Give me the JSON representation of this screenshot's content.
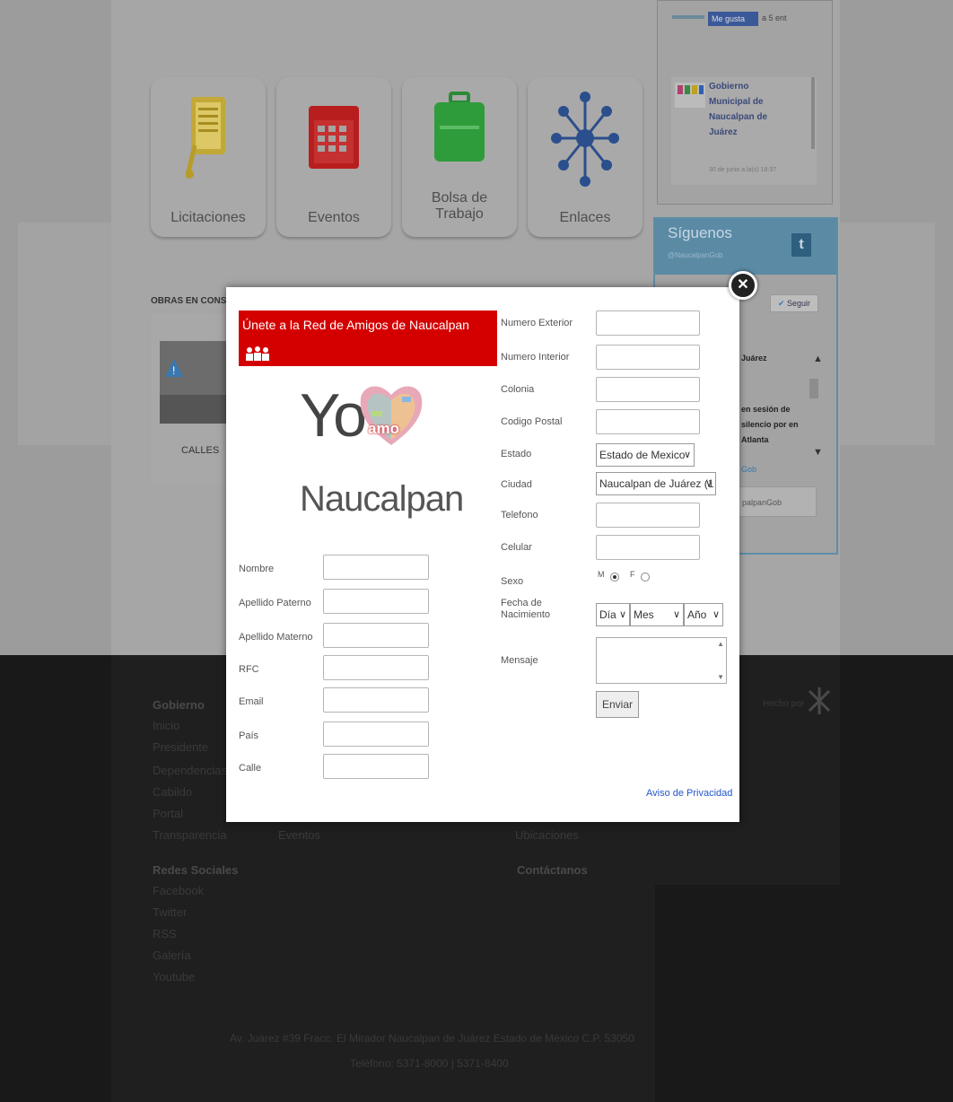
{
  "tiles": [
    {
      "label": "Licitaciones",
      "icon": "clipboard-icon",
      "color": "#d4b62a"
    },
    {
      "label": "Eventos",
      "icon": "calendar-icon",
      "color": "#c81e1e"
    },
    {
      "label": "Bolsa de\nTrabajo",
      "icon": "briefcase-icon",
      "color": "#2e9c3a"
    },
    {
      "label": "Enlaces",
      "icon": "network-icon",
      "color": "#2a4f8c"
    }
  ],
  "sidebar": {
    "like_label": "Me gusta",
    "like_extra": "a 5 ent",
    "news_title": "Gobierno Municipal de Naucalpan de Juárez",
    "news_date": "30 de junio a la(s) 18:37",
    "twitter_title": "Síguenos",
    "twitter_handle": "@NaucalpanGob",
    "tweet_button": "Seguir",
    "tweet_name": "Juárez",
    "tweet_text": "en sesión de silencio por en Atlanta",
    "tweet_link": "Gob",
    "tweet_input": "palpanGob"
  },
  "obras": {
    "title": "OBRAS EN CONST",
    "caption": "CALLES"
  },
  "footer": {
    "gobierno_head": "Gobierno",
    "gobierno_items": [
      "Inicio",
      "Presidente",
      "Dependencias",
      "Cabildo",
      "Portal",
      "Transparencia"
    ],
    "col2_item": "Eventos",
    "col3_item": "Ubicaciones",
    "redes_head": "Redes Sociales",
    "redes_items": [
      "Facebook",
      "Twitter",
      "RSS",
      "Galería",
      "Youtube"
    ],
    "contact_head": "Contáctanos",
    "hecho_por": "Hecho por",
    "address": "Av. Juárez #39 Fracc. El Mirador Naucalpan de Juárez Estado de México C.P. 53050",
    "phone": "Teléfono: 5371-8000 | 5371-8400"
  },
  "modal": {
    "banner_title": "Únete a la Red de Amigos de Naucalpan",
    "logo_yo": "Yo",
    "logo_amo": "amo",
    "logo_place": "Naucalpan",
    "left_fields": [
      {
        "label": "Nombre"
      },
      {
        "label": "Apellido Paterno"
      },
      {
        "label": "Apellido Materno"
      },
      {
        "label": "RFC"
      },
      {
        "label": "Email"
      },
      {
        "label": "País"
      },
      {
        "label": "Calle"
      }
    ],
    "right_fields": [
      {
        "label": "Numero Exterior"
      },
      {
        "label": "Numero Interior"
      },
      {
        "label": "Colonia"
      },
      {
        "label": "Codigo Postal"
      }
    ],
    "estado_label": "Estado",
    "estado_value": "Estado de Mexico",
    "ciudad_label": "Ciudad",
    "ciudad_value": "Naucalpan de Juárez (1",
    "telefono_label": "Telefono",
    "celular_label": "Celular",
    "sexo_label": "Sexo",
    "sexo_m": "M",
    "sexo_f": "F",
    "sexo_selected": "M",
    "fecha_label": "Fecha de Nacimiento",
    "dia_value": "Día",
    "mes_value": "Mes",
    "anio_value": "Año",
    "mensaje_label": "Mensaje",
    "send_label": "Enviar",
    "privacy_label": "Aviso de Privacidad",
    "close_label": "✕"
  }
}
